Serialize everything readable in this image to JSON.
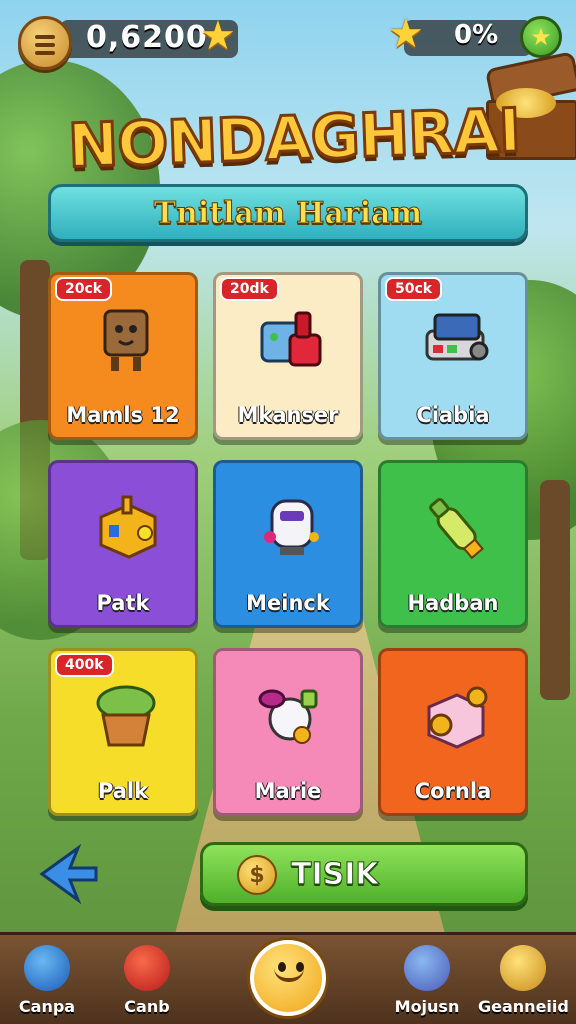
{
  "header": {
    "coins": "0,6200",
    "progress": "0%",
    "title": "NONDAGHRAI",
    "subtitle": "Tnitlam Hariam"
  },
  "cards": [
    {
      "label": "Mamls 12",
      "badge": "20ck",
      "color": "#f58a1f",
      "icon": "robot-box-icon"
    },
    {
      "label": "Mkanser",
      "badge": "20dk",
      "color": "#fbecc5",
      "icon": "machine-icon"
    },
    {
      "label": "Ciabia",
      "badge": "50ck",
      "color": "#9fdcf2",
      "icon": "gadget-icon"
    },
    {
      "label": "Patk",
      "badge": "",
      "color": "#8a4fd6",
      "icon": "puzzle-box-icon"
    },
    {
      "label": "Meinck",
      "badge": "",
      "color": "#2c8ee0",
      "icon": "robot-icon"
    },
    {
      "label": "Hadban",
      "badge": "",
      "color": "#3fc04a",
      "icon": "bottle-icon"
    },
    {
      "label": "Palk",
      "badge": "400k",
      "color": "#f6dd2a",
      "icon": "plant-pot-icon"
    },
    {
      "label": "Marie",
      "badge": "",
      "color": "#f58ab8",
      "icon": "bulb-icon"
    },
    {
      "label": "Cornla",
      "badge": "",
      "color": "#f2651f",
      "icon": "coin-box-icon"
    }
  ],
  "action": {
    "label": "TISIK",
    "coin_symbol": "$"
  },
  "nav": [
    {
      "label": "Canpa",
      "icon": "blue-creature-icon"
    },
    {
      "label": "Canb",
      "icon": "red-creature-icon"
    },
    {
      "label": "",
      "icon": "smiley-icon"
    },
    {
      "label": "Mojusn",
      "icon": "gamepad-icon"
    },
    {
      "label": "Geanneiid",
      "icon": "shell-icon"
    }
  ]
}
